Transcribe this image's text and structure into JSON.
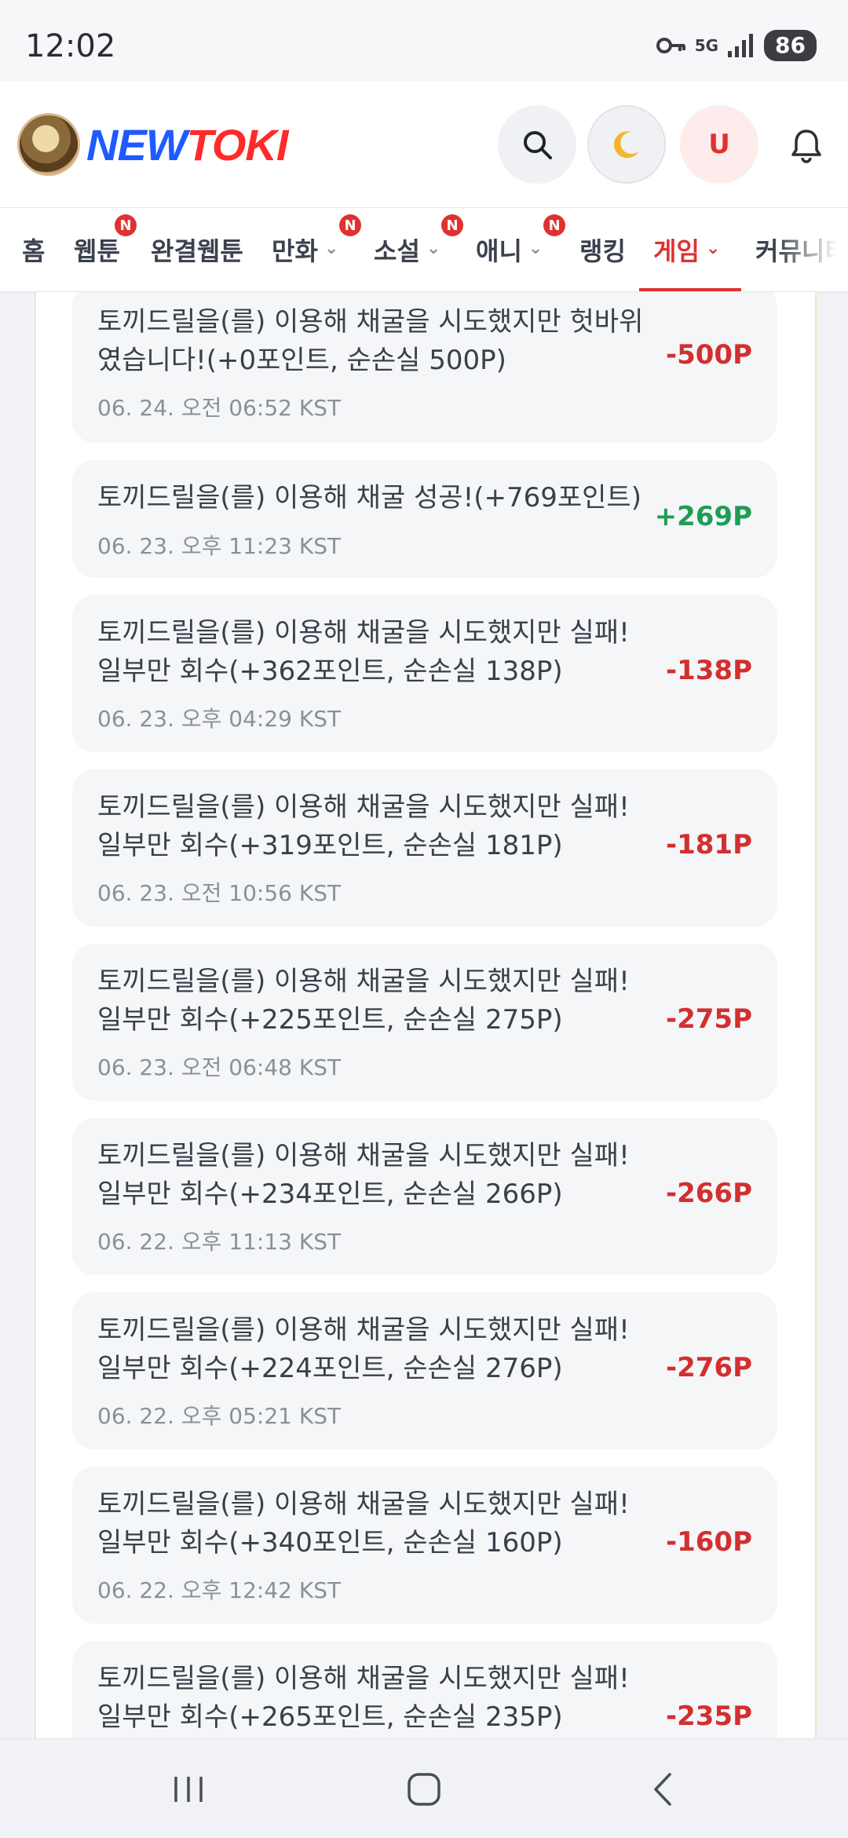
{
  "status": {
    "time": "12:02",
    "network": "5G",
    "battery": "86"
  },
  "header": {
    "logo_new": "NEW",
    "logo_toki": "TOKI",
    "user_initial": "U"
  },
  "nav": {
    "items": [
      {
        "label": "홈"
      },
      {
        "label": "웹툰",
        "badge": "N"
      },
      {
        "label": "완결웹툰"
      },
      {
        "label": "만화",
        "badge": "N"
      },
      {
        "label": "소설",
        "badge": "N"
      },
      {
        "label": "애니",
        "badge": "N"
      },
      {
        "label": "랭킹"
      },
      {
        "label": "게임"
      },
      {
        "label": "커뮤니티"
      }
    ],
    "active": "게임"
  },
  "history": [
    {
      "text": "토끼드릴을(를) 이용해 채굴을 시도했지만 헛바위였습니다!(+0포인트, 순손실 500P)",
      "time": "06. 24. 오전 06:52 KST",
      "amount": "-500P",
      "type": "negative"
    },
    {
      "text": "토끼드릴을(를) 이용해 채굴 성공!(+769포인트)",
      "time": "06. 23. 오후 11:23 KST",
      "amount": "+269P",
      "type": "positive"
    },
    {
      "text": "토끼드릴을(를) 이용해 채굴을 시도했지만 실패! 일부만 회수(+362포인트, 순손실 138P)",
      "time": "06. 23. 오후 04:29 KST",
      "amount": "-138P",
      "type": "negative"
    },
    {
      "text": "토끼드릴을(를) 이용해 채굴을 시도했지만 실패! 일부만 회수(+319포인트, 순손실 181P)",
      "time": "06. 23. 오전 10:56 KST",
      "amount": "-181P",
      "type": "negative"
    },
    {
      "text": "토끼드릴을(를) 이용해 채굴을 시도했지만 실패! 일부만 회수(+225포인트, 순손실 275P)",
      "time": "06. 23. 오전 06:48 KST",
      "amount": "-275P",
      "type": "negative"
    },
    {
      "text": "토끼드릴을(를) 이용해 채굴을 시도했지만 실패! 일부만 회수(+234포인트, 순손실 266P)",
      "time": "06. 22. 오후 11:13 KST",
      "amount": "-266P",
      "type": "negative"
    },
    {
      "text": "토끼드릴을(를) 이용해 채굴을 시도했지만 실패! 일부만 회수(+224포인트, 순손실 276P)",
      "time": "06. 22. 오후 05:21 KST",
      "amount": "-276P",
      "type": "negative"
    },
    {
      "text": "토끼드릴을(를) 이용해 채굴을 시도했지만 실패! 일부만 회수(+340포인트, 순손실 160P)",
      "time": "06. 22. 오후 12:42 KST",
      "amount": "-160P",
      "type": "negative"
    },
    {
      "text": "토끼드릴을(를) 이용해 채굴을 시도했지만 실패! 일부만 회수(+265포인트, 순손실 235P)",
      "time": "",
      "amount": "-235P",
      "type": "negative"
    }
  ],
  "colors": {
    "negative": "#d32f2f",
    "positive": "#1f9d55",
    "accent": "#e03131"
  }
}
